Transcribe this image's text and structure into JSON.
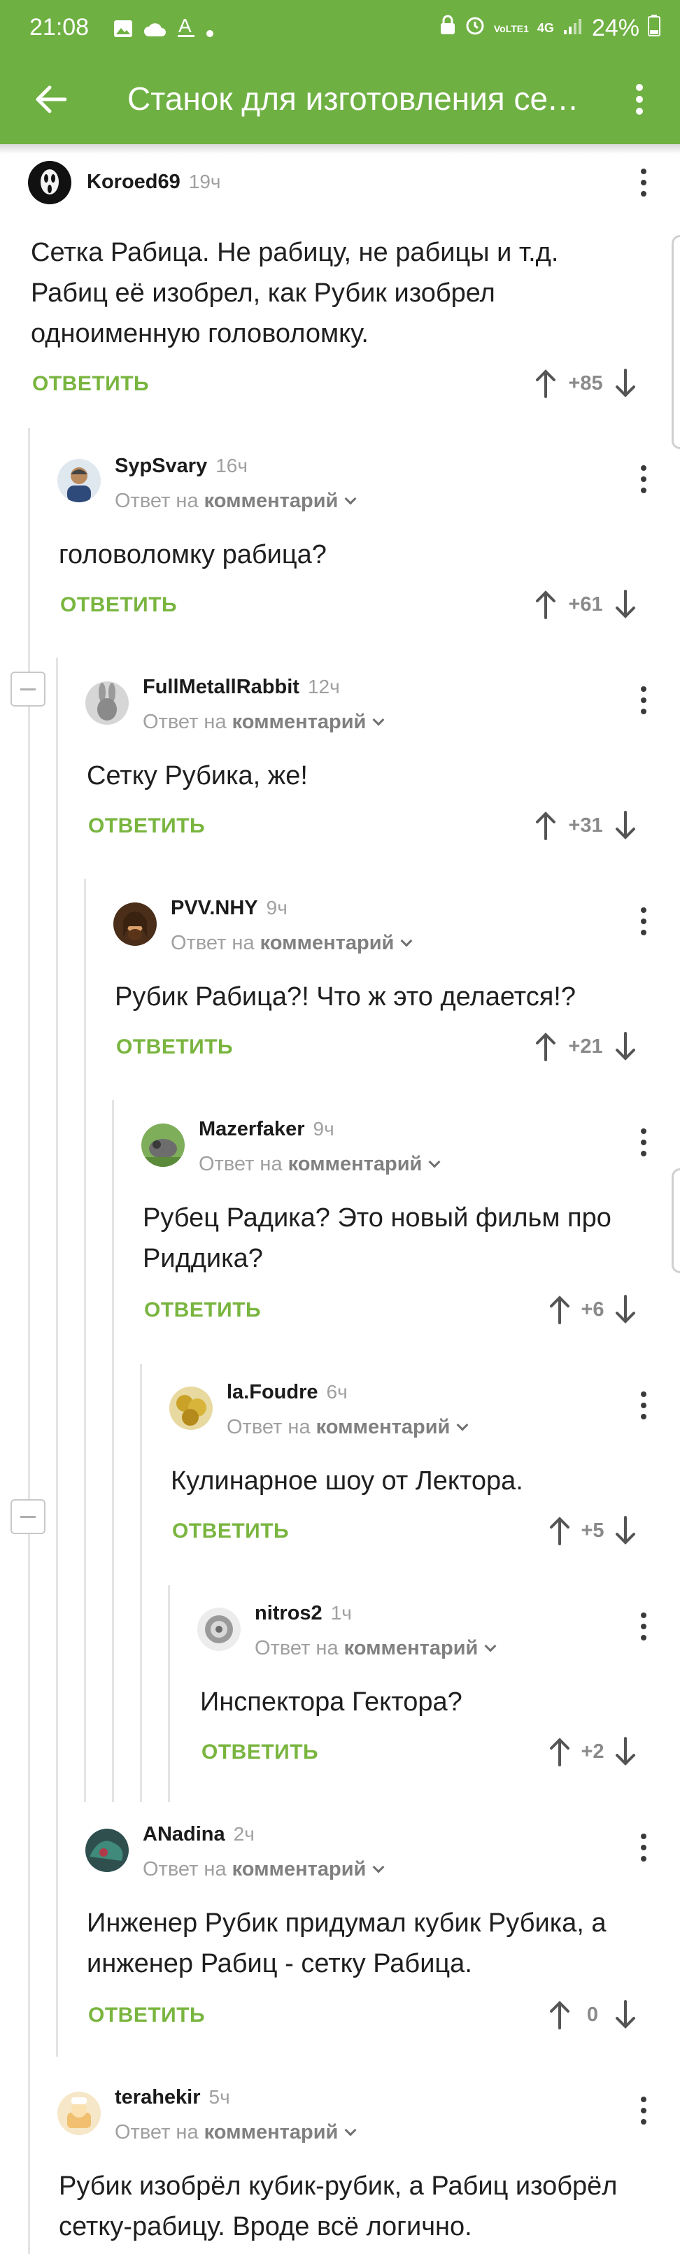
{
  "status": {
    "time": "21:08",
    "battery": "24%",
    "network": "4G",
    "carrier": "VoLTE1"
  },
  "appbar": {
    "title": "Станок для изготовления сетки Рабица"
  },
  "labels": {
    "reply": "ОТВЕТИТЬ",
    "reply_to": "Ответ на",
    "reply_to_target": "комментарий"
  },
  "comments": [
    {
      "author": "Koroed69",
      "time": "19ч",
      "text": "Сетка Рабица. Не рабицу, не рабицы и т.д. Рабиц её изобрел, как Рубик изобрел одноименную головоломку.",
      "score": "+85",
      "is_reply": false
    },
    {
      "author": "SypSvary",
      "time": "16ч",
      "text": "головоломку рабица?",
      "score": "+61",
      "is_reply": true
    },
    {
      "author": "FullMetallRabbit",
      "time": "12ч",
      "text": "Сетку Рубика, же!",
      "score": "+31",
      "is_reply": true
    },
    {
      "author": "PVV.NHY",
      "time": "9ч",
      "text": "Рубик Рабица?! Что ж это делается!?",
      "score": "+21",
      "is_reply": true
    },
    {
      "author": "Mazerfaker",
      "time": "9ч",
      "text": "Рубец Радика? Это новый фильм про Риддика?",
      "score": "+6",
      "is_reply": true
    },
    {
      "author": "la.Foudre",
      "time": "6ч",
      "text": "Кулинарное шоу от Лектора.",
      "score": "+5",
      "is_reply": true
    },
    {
      "author": "nitros2",
      "time": "1ч",
      "text": "Инспектора Гектора?",
      "score": "+2",
      "is_reply": true
    },
    {
      "author": "ANadina",
      "time": "2ч",
      "text": "Инженер Рубик придумал кубик Рубика, а инженер Рабиц - сетку Рабица.",
      "score": "0",
      "is_reply": true
    },
    {
      "author": "terahekir",
      "time": "5ч",
      "text": "Рубик изобрёл кубик-рубик, а Рабиц изобрёл сетку-рабицу. Вроде всё логично.",
      "score": "",
      "is_reply": true
    }
  ],
  "colors": {
    "accent": "#6fb043",
    "reply_button": "#79b53f"
  },
  "icons": [
    "back-arrow-icon",
    "more-vert-icon",
    "upvote-arrow-icon",
    "downvote-arrow-icon",
    "collapse-minus-icon",
    "chevron-down-icon"
  ]
}
